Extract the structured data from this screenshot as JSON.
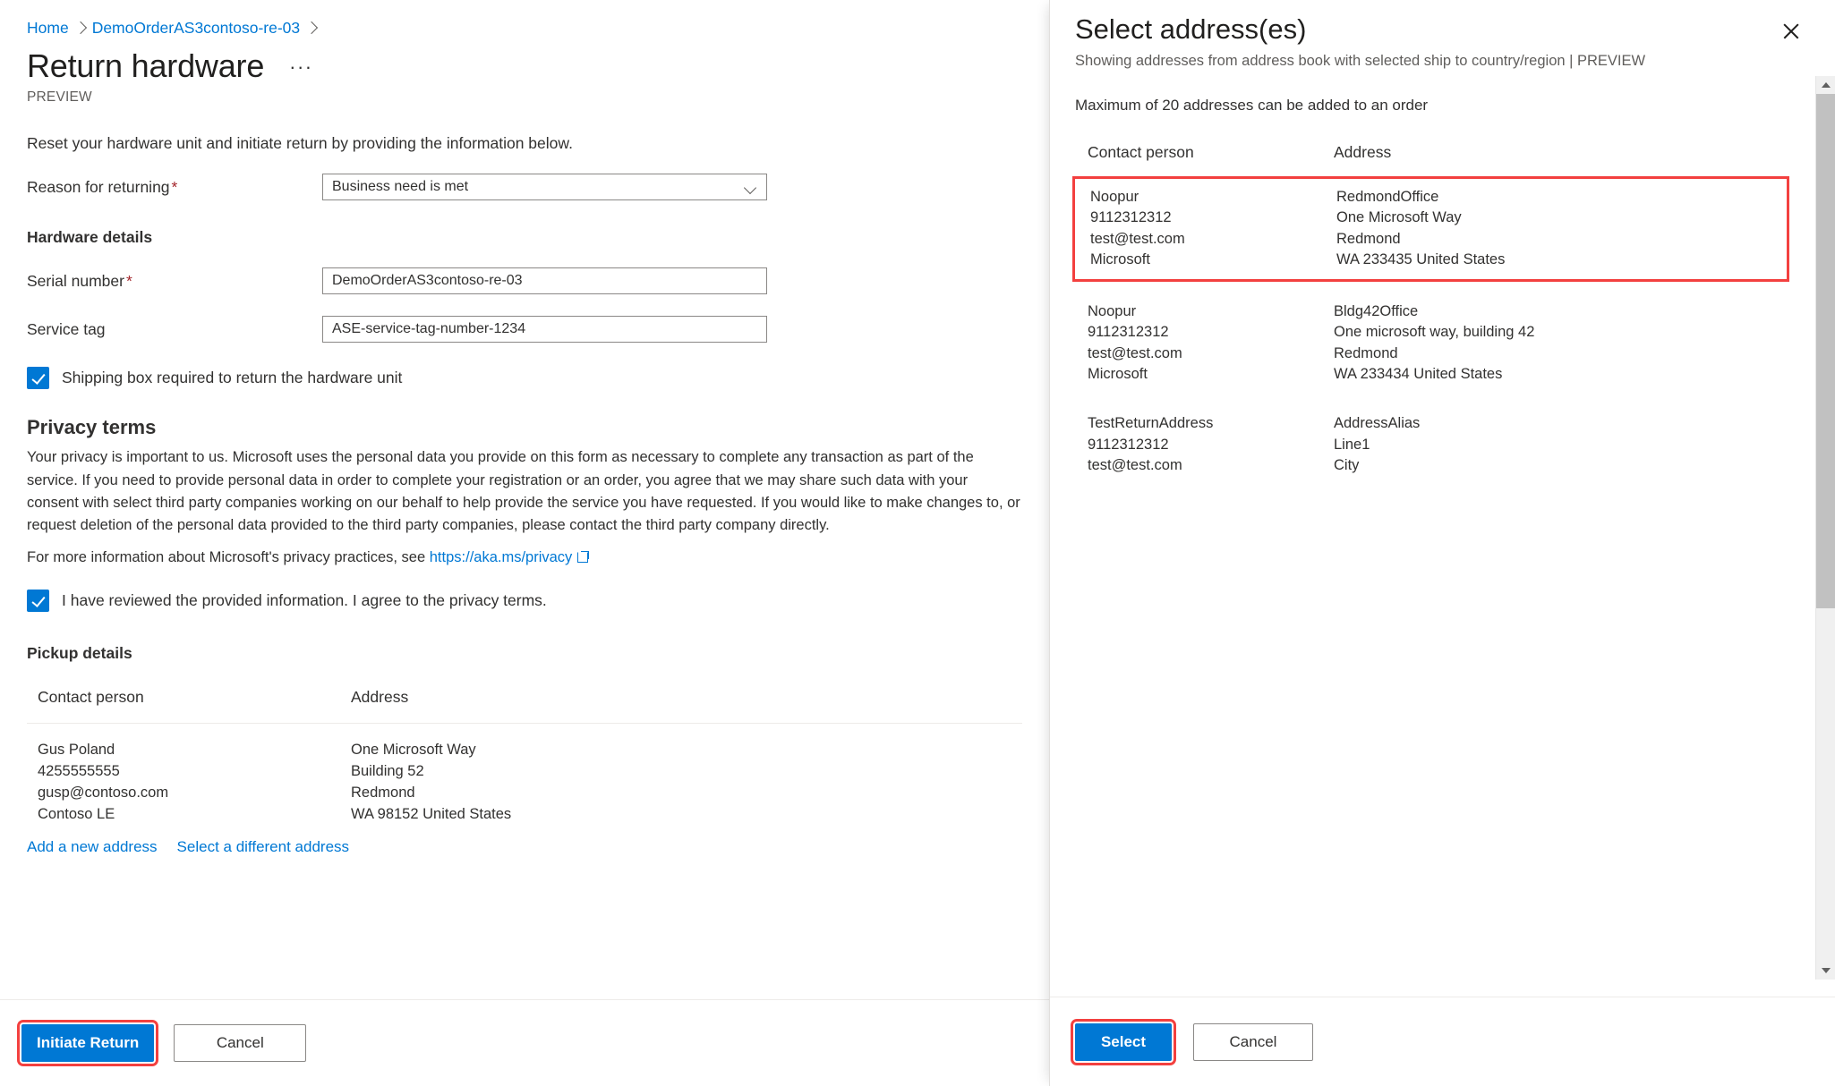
{
  "breadcrumb": {
    "items": [
      {
        "label": "Home"
      },
      {
        "label": "DemoOrderAS3contoso-re-03"
      }
    ]
  },
  "page": {
    "title": "Return hardware",
    "overflow_label": "···",
    "preview_tag": "PREVIEW",
    "intro": "Reset your hardware unit and initiate return by providing the information below."
  },
  "form": {
    "reason": {
      "label": "Reason for returning",
      "required_marker": "*",
      "value": "Business need is met",
      "options": [
        "Business need is met"
      ]
    },
    "hardware_details_heading": "Hardware details",
    "serial_number": {
      "label": "Serial number",
      "required_marker": "*",
      "value": "DemoOrderAS3contoso-re-03",
      "placeholder": "Serial number"
    },
    "service_tag": {
      "label": "Service tag",
      "value": "ASE-service-tag-number-1234",
      "placeholder": "Service tag"
    },
    "shipping_box_checkbox": {
      "label": "Shipping box required to return the hardware unit",
      "checked": true
    }
  },
  "privacy": {
    "heading": "Privacy terms",
    "body": "Your privacy is important to us. Microsoft uses the personal data you provide on this form as necessary to complete any transaction as part of the service. If you need to provide personal data in order to complete your registration or an order, you agree that we may share such data with your consent with select third party companies working on our behalf to help provide the service you have requested. If you would like to make changes to, or request deletion of the personal data provided to the third party companies, please contact the third party company directly.",
    "more_info_prefix": "For more information about Microsoft's privacy practices, see",
    "link_text": "https://aka.ms/privacy",
    "consent_checkbox": {
      "label": "I have reviewed the provided information. I agree to the privacy terms.",
      "checked": true
    }
  },
  "pickup": {
    "heading": "Pickup details",
    "columns": {
      "contact": "Contact person",
      "address": "Address"
    },
    "row": {
      "contact": [
        "Gus Poland",
        "4255555555",
        "gusp@contoso.com",
        "Contoso LE"
      ],
      "address": [
        "One Microsoft Way",
        "Building 52",
        "Redmond",
        "WA 98152 United States"
      ]
    },
    "links": {
      "add_new": "Add a new address",
      "select_different": "Select a different address"
    }
  },
  "footer": {
    "initiate_return": "Initiate Return",
    "cancel": "Cancel"
  },
  "panel": {
    "title": "Select address(es)",
    "subtitle": "Showing addresses from address book with selected ship to country/region | PREVIEW",
    "close_label": "Close",
    "note": "Maximum of 20 addresses can be added to an order",
    "columns": {
      "contact": "Contact person",
      "address": "Address"
    },
    "addresses": [
      {
        "selected": true,
        "contact": [
          "Noopur",
          "9112312312",
          "test@test.com",
          "Microsoft"
        ],
        "address": [
          "RedmondOffice",
          "One Microsoft Way",
          "Redmond",
          "WA 233435 United States"
        ]
      },
      {
        "selected": false,
        "contact": [
          "Noopur",
          "9112312312",
          "test@test.com",
          "Microsoft"
        ],
        "address": [
          "Bldg42Office",
          "One microsoft way, building 42",
          "Redmond",
          "WA 233434 United States"
        ]
      },
      {
        "selected": false,
        "contact": [
          "TestReturnAddress",
          "9112312312",
          "test@test.com"
        ],
        "address": [
          "AddressAlias",
          "Line1",
          "City"
        ]
      }
    ],
    "footer": {
      "select": "Select",
      "cancel": "Cancel"
    }
  },
  "colors": {
    "accent": "#0078d4",
    "highlight": "#f3403f",
    "required": "#a4262c",
    "link": "#0078d4"
  }
}
